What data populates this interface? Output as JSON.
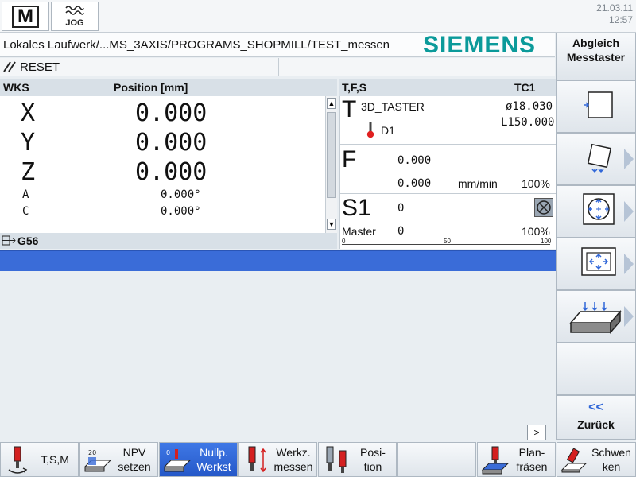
{
  "header": {
    "mode_m_label": "M",
    "mode_jog_label": "JOG",
    "date": "21.03.11",
    "time": "12:57"
  },
  "path": "Lokales Laufwerk/...MS_3AXIS/PROGRAMS_SHOPMILL/TEST_messen",
  "brand": "SIEMENS",
  "reset_text": "RESET",
  "wks": {
    "header_label": "WKS",
    "header_position": "Position [mm]",
    "axes": [
      {
        "name": "X",
        "value": "0.000"
      },
      {
        "name": "Y",
        "value": "0.000"
      },
      {
        "name": "Z",
        "value": "0.000"
      },
      {
        "name": "A",
        "value": "0.000°"
      },
      {
        "name": "C",
        "value": "0.000°"
      }
    ],
    "frame": "G56"
  },
  "tfs": {
    "header_label": "T,F,S",
    "header_tool": "TC1",
    "t_letter": "T",
    "tool_name": "3D_TASTER",
    "tool_diameter": "ø18.030",
    "tool_length": "L150.000",
    "d_number": "D1",
    "f_letter": "F",
    "f_value": "0.000",
    "f_actual": "0.000",
    "f_unit": "mm/min",
    "f_percent": "100%",
    "s_label": "S1",
    "s_value": "0",
    "master_label": "Master",
    "master_value": "0",
    "master_percent": "100%",
    "scale": [
      "0",
      "50",
      "100"
    ],
    "spindle_load_fraction": 0.0
  },
  "hscroll_label": ">",
  "right_softkeys": {
    "k1": "Abgleich Messtaster",
    "k1a": "Abgleich",
    "k1b": "Messtaster",
    "back": "Zurück",
    "back_icon": "<<"
  },
  "bottom_softkeys": [
    {
      "l1": "T,S,M",
      "l2": ""
    },
    {
      "l1": "NPV",
      "l2": "setzen"
    },
    {
      "l1": "Nullp.",
      "l2": "Werkst"
    },
    {
      "l1": "Werkz.",
      "l2": "messen"
    },
    {
      "l1": "Posi-",
      "l2": "tion"
    },
    {
      "l1": "",
      "l2": ""
    },
    {
      "l1": "Plan-",
      "l2": "fräsen"
    },
    {
      "l1": "Schwen",
      "l2": "ken"
    }
  ],
  "colors": {
    "siemens_teal": "#0b9a9a",
    "active_blue": "#2f66d8",
    "header_gray": "#d8e0e7"
  }
}
